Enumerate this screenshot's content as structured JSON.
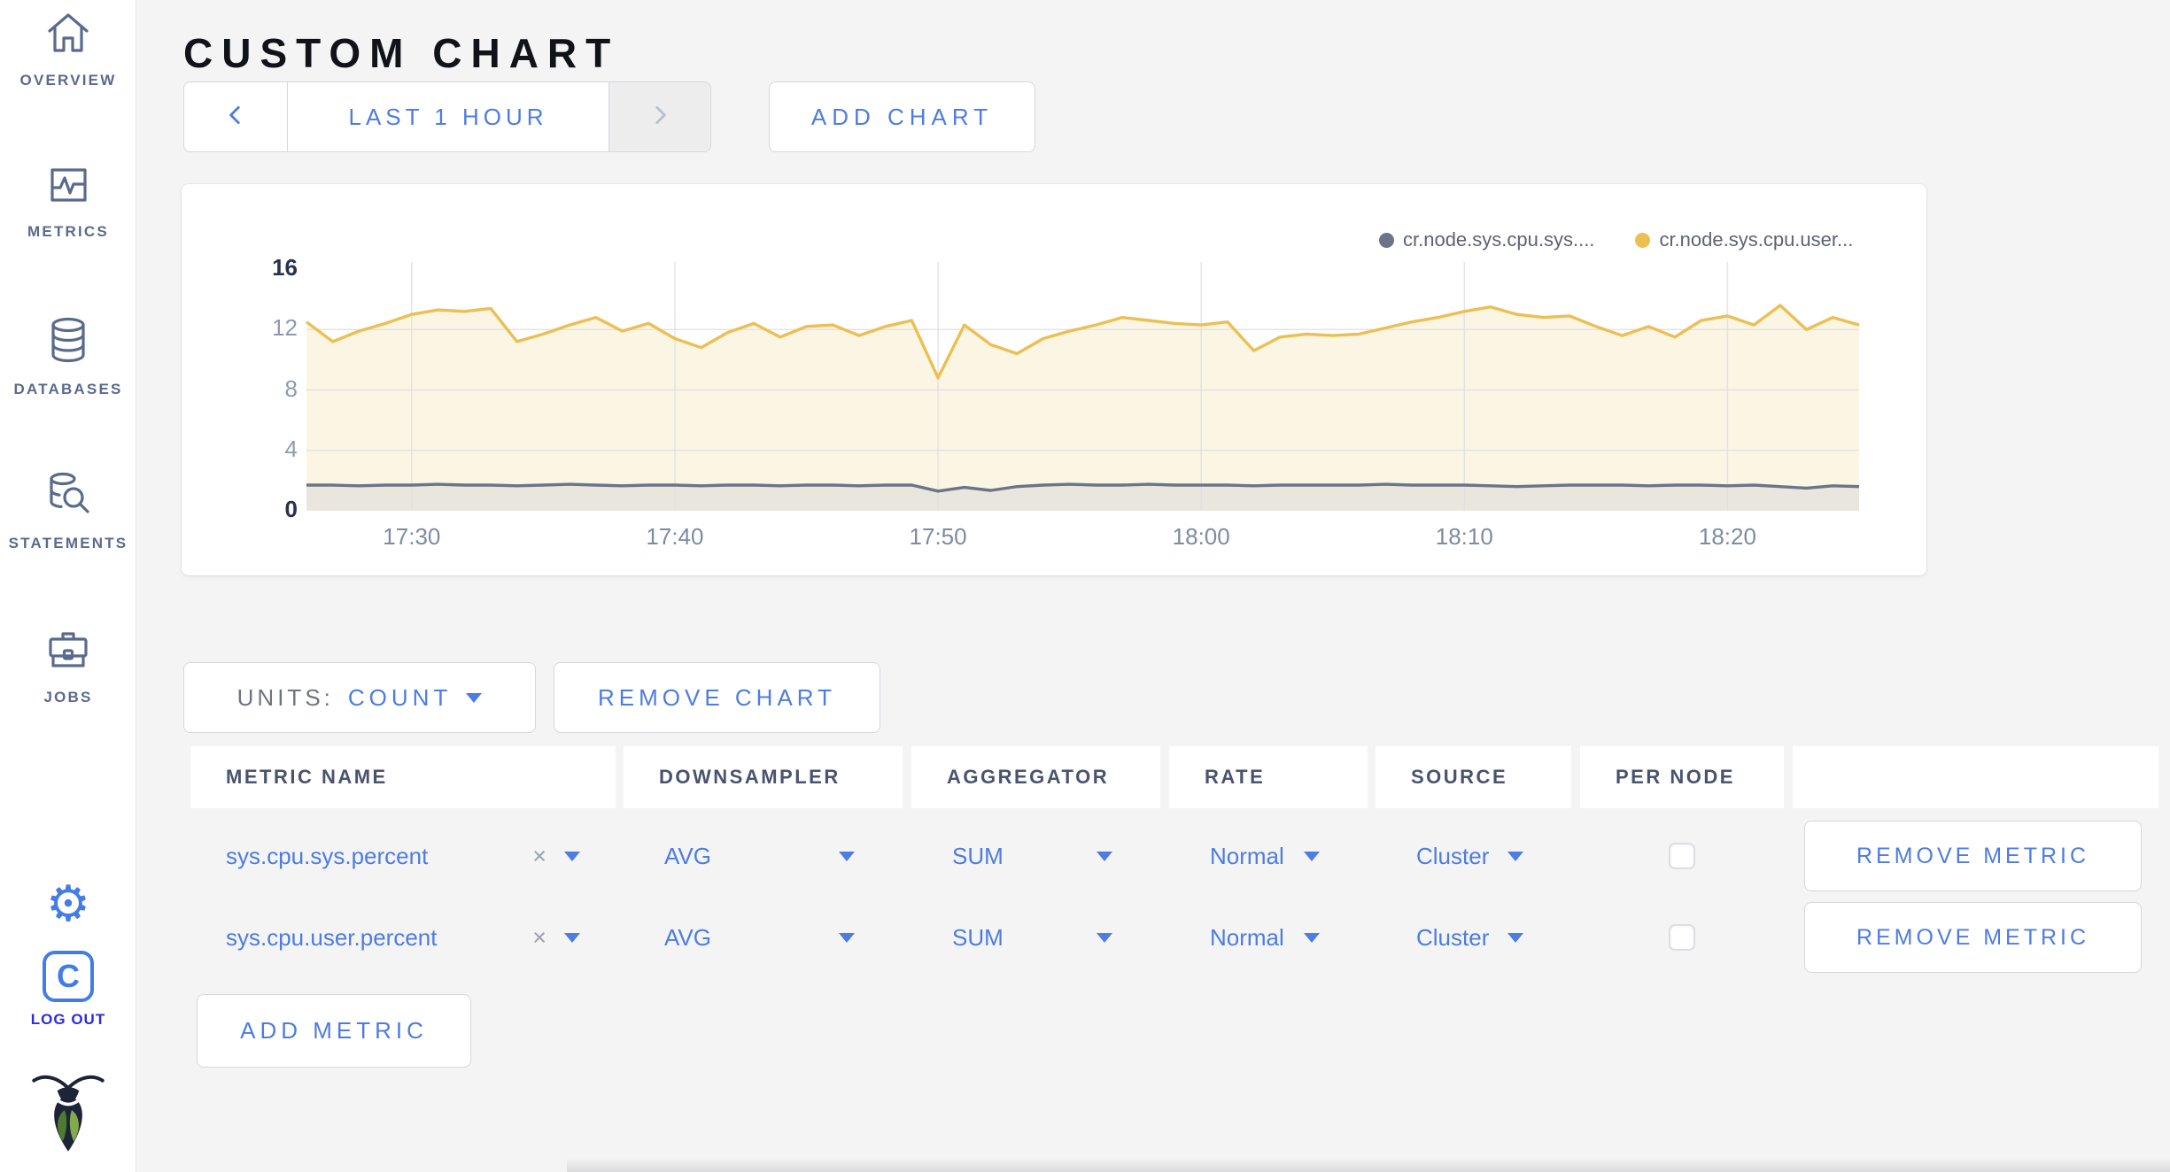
{
  "app": {
    "title": "CUSTOM CHART"
  },
  "icons": {
    "gear": "⚙",
    "close": "×"
  },
  "colors": {
    "accent": "#4d7ce2",
    "nav_slate": "#596b8c",
    "logout_blue": "#2b2bdb",
    "icon_blue": "#437de4"
  },
  "sidebar": {
    "items": [
      {
        "label": "OVERVIEW"
      },
      {
        "label": "METRICS"
      },
      {
        "label": "DATABASES"
      },
      {
        "label": "STATEMENTS"
      },
      {
        "label": "JOBS"
      }
    ],
    "logout_label": "LOG OUT"
  },
  "toolbar": {
    "time_range": "LAST 1 HOUR",
    "add_chart": "ADD CHART",
    "prev_enabled": true,
    "next_enabled": false
  },
  "chart_controls": {
    "units_label": "UNITS:",
    "units_value": "COUNT",
    "remove_chart": "REMOVE CHART",
    "remove_metric": "REMOVE METRIC",
    "add_metric": "ADD METRIC"
  },
  "table": {
    "headers": [
      "METRIC NAME",
      "DOWNSAMPLER",
      "AGGREGATOR",
      "RATE",
      "SOURCE",
      "PER NODE",
      ""
    ],
    "rows": [
      {
        "metric": "sys.cpu.sys.percent",
        "downsampler": "AVG",
        "aggregator": "SUM",
        "rate": "Normal",
        "source": "Cluster",
        "per_node": false
      },
      {
        "metric": "sys.cpu.user.percent",
        "downsampler": "AVG",
        "aggregator": "SUM",
        "rate": "Normal",
        "source": "Cluster",
        "per_node": false
      }
    ]
  },
  "chart_data": {
    "type": "area",
    "title": "",
    "x_start": "17:26",
    "x_end": "18:25",
    "x_step_minutes": 1,
    "xticks": [
      "17:30",
      "17:40",
      "17:50",
      "18:00",
      "18:10",
      "18:20"
    ],
    "ylim": [
      0,
      16
    ],
    "yticks": [
      0,
      4,
      8,
      12,
      16
    ],
    "grid": true,
    "legend_position": "top-right",
    "series": [
      {
        "name": "cr.node.sys.cpu.sys....",
        "color": "#6b7488",
        "fill": "#e9e6dd",
        "values": [
          1.7,
          1.7,
          1.65,
          1.7,
          1.7,
          1.75,
          1.7,
          1.7,
          1.65,
          1.7,
          1.75,
          1.7,
          1.65,
          1.7,
          1.7,
          1.65,
          1.7,
          1.7,
          1.65,
          1.7,
          1.7,
          1.65,
          1.7,
          1.7,
          1.3,
          1.55,
          1.35,
          1.6,
          1.7,
          1.75,
          1.7,
          1.7,
          1.75,
          1.7,
          1.7,
          1.7,
          1.65,
          1.7,
          1.7,
          1.7,
          1.7,
          1.75,
          1.7,
          1.7,
          1.7,
          1.65,
          1.6,
          1.65,
          1.7,
          1.7,
          1.7,
          1.65,
          1.7,
          1.7,
          1.65,
          1.7,
          1.6,
          1.5,
          1.65,
          1.6
        ]
      },
      {
        "name": "cr.node.sys.cpu.user...",
        "color": "#ecbf52",
        "fill": "#fbf5e4",
        "values": [
          12.5,
          11.2,
          11.9,
          12.4,
          13.0,
          13.3,
          13.2,
          13.4,
          11.2,
          11.7,
          12.3,
          12.8,
          11.9,
          12.4,
          11.4,
          10.8,
          11.8,
          12.4,
          11.5,
          12.2,
          12.3,
          11.6,
          12.2,
          12.6,
          8.8,
          12.3,
          11.0,
          10.4,
          11.4,
          11.9,
          12.3,
          12.8,
          12.6,
          12.4,
          12.3,
          12.5,
          10.6,
          11.5,
          11.7,
          11.6,
          11.7,
          12.1,
          12.5,
          12.8,
          13.2,
          13.5,
          13.0,
          12.8,
          12.9,
          12.2,
          11.6,
          12.2,
          11.5,
          12.6,
          12.9,
          12.3,
          13.6,
          12.0,
          12.8,
          12.3
        ]
      }
    ]
  }
}
